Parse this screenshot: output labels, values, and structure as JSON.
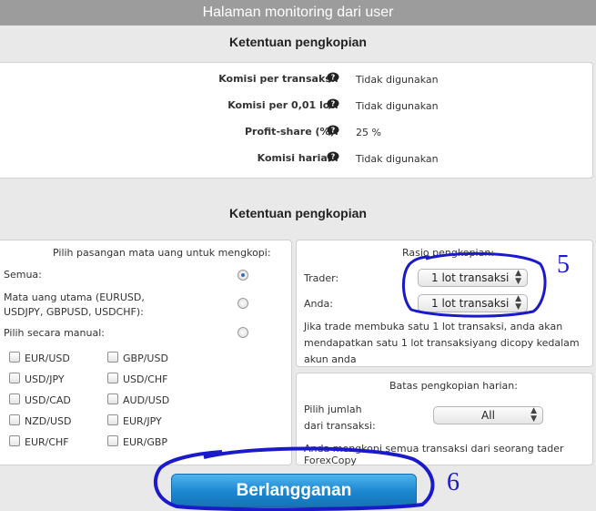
{
  "header": {
    "title": "Halaman monitoring dari user"
  },
  "terms": {
    "title": "Ketentuan pengkopian",
    "rows": [
      {
        "label": "Komisi per transaksi:",
        "value": "Tidak digunakan"
      },
      {
        "label": "Komisi per 0,01 lot:",
        "value": "Tidak digunakan"
      },
      {
        "label": "Profit-share (%):",
        "value": "25 %"
      },
      {
        "label": "Komisi harian:",
        "value": "Tidak digunakan"
      }
    ]
  },
  "copy_terms": {
    "title": "Ketentuan pengkopian",
    "pairs_panel": {
      "heading": "Pilih pasangan mata uang untuk mengkopi:",
      "options": [
        {
          "label": "Semua:",
          "checked": true
        },
        {
          "label": "Mata uang utama (EURUSD, USDJPY, GBPUSD, USDCHF):",
          "checked": false
        },
        {
          "label": "Pilih secara manual:",
          "checked": false
        }
      ],
      "pairs_left": [
        "EUR/USD",
        "USD/JPY",
        "USD/CAD",
        "NZD/USD",
        "EUR/CHF"
      ],
      "pairs_right": [
        "GBP/USD",
        "USD/CHF",
        "AUD/USD",
        "EUR/JPY",
        "EUR/GBP"
      ]
    },
    "ratio_panel": {
      "heading": "Rasio pengkopian:",
      "trader_label": "Trader:",
      "trader_value": "1 lot transaksi",
      "you_label": "Anda:",
      "you_value": "1 lot transaksi",
      "note": "Jika trade membuka satu 1 lot transaksi, anda akan mendapatkan satu 1 lot transaksiyang dicopy kedalam akun anda"
    },
    "limit_panel": {
      "heading": "Batas pengkopian harian:",
      "label": "Pilih jumlah dari transaksi:",
      "value": "All",
      "note": "Anda mengkopi semua transaksi dari seorang tader ForexCopy"
    }
  },
  "subscribe_button": "Berlangganan",
  "annotations": {
    "five": "5",
    "six": "6"
  },
  "colors": {
    "accent": "#1b86cf",
    "annotation": "#1a1acc",
    "header": "#9c9c9c"
  }
}
